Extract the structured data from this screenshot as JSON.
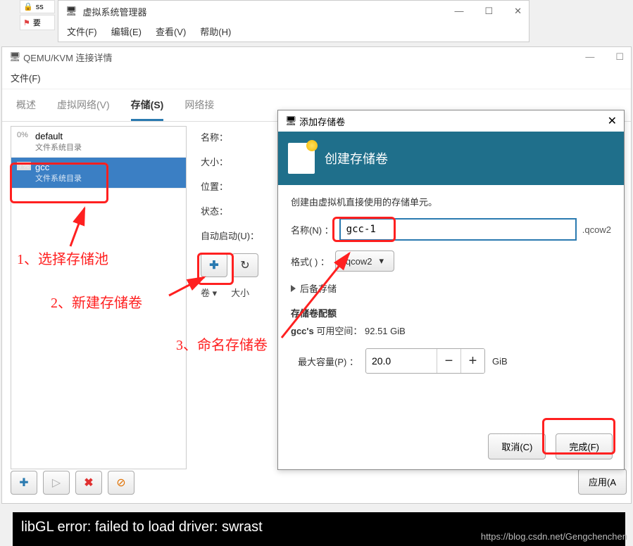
{
  "topTabs": {
    "t1": "ss",
    "t2": "要"
  },
  "vmManager": {
    "title": "虚拟系统管理器",
    "menu": {
      "file": "文件(F)",
      "edit": "编辑(E)",
      "view": "查看(V)",
      "help": "帮助(H)"
    }
  },
  "connWin": {
    "title": "QEMU/KVM 连接详情",
    "menu_file": "文件(F)",
    "tabs": {
      "overview": "概述",
      "vnet": "虚拟网络(V)",
      "storage": "存储(S)",
      "netif": "网络接"
    },
    "pools": [
      {
        "pct": "0%",
        "name": "default",
        "sub": "文件系统目录"
      },
      {
        "pct": "7%",
        "name": "gcc",
        "sub": "文件系统目录"
      }
    ],
    "detail": {
      "name_label": "名称：",
      "size_label": "大小：",
      "location_label": "位置：",
      "state_label": "状态：",
      "autostart_label": "自动启动(U)：",
      "vol_col": "卷 ▾",
      "size_col": "大小"
    },
    "apply": "应用(A"
  },
  "dialog": {
    "title": "添加存储卷",
    "banner": "创建存储卷",
    "desc": "创建由虚拟机直接使用的存储单元。",
    "name_label": "名称(N) ：",
    "name_value": "gcc-1",
    "ext": ".qcow2",
    "format_label": "格式(   ) ：",
    "format_value": "qcow2",
    "backing": "后备存储",
    "quota_title": "存储卷配额",
    "quota_pool": "gcc's",
    "quota_text": "可用空间：",
    "quota_size": "92.51 GiB",
    "cap_label": "最大容量(P) ：",
    "cap_value": "20.0",
    "cap_unit": "GiB",
    "cancel": "取消(C)",
    "finish": "完成(F)"
  },
  "annotations": {
    "a1": "1、选择存储池",
    "a2": "2、新建存储卷",
    "a3": "3、命名存储卷"
  },
  "terminal": "libGL error: failed to load driver: swrast",
  "watermark": "https://blog.csdn.net/Gengchenchen"
}
